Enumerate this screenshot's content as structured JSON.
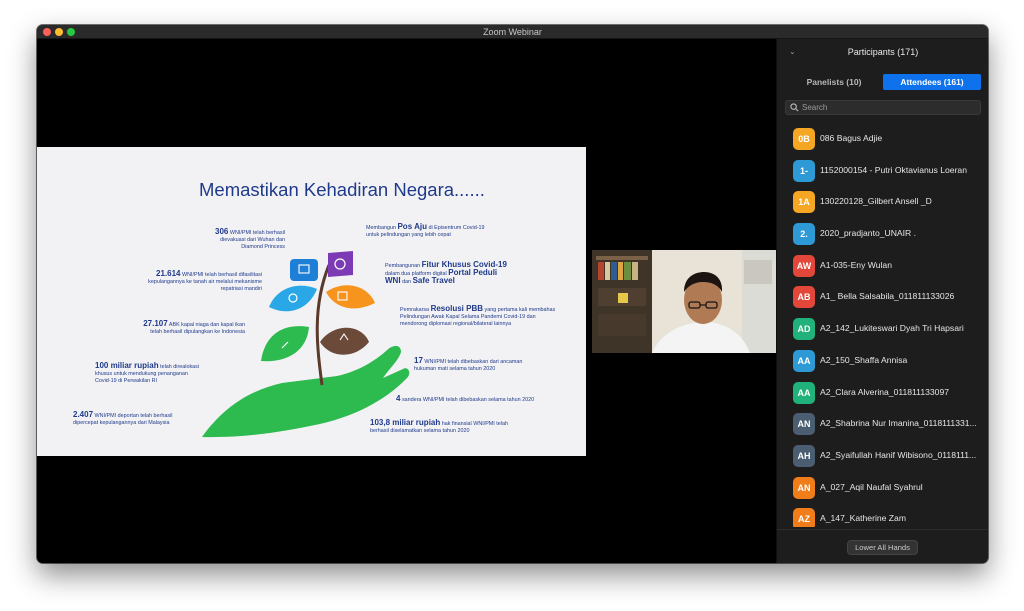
{
  "window": {
    "title": "Zoom Webinar"
  },
  "slide": {
    "title": "Memastikan Kehadiran Negara......",
    "left": [
      {
        "big": "306",
        "text": "WNI/PMI telah berhasil",
        "l2": "dievakuasi dari Wuhan dan",
        "l3": "Diamond Princess"
      },
      {
        "big": "21.614",
        "text": "WNI/PMI telah berhasil difasilitasi",
        "l2": "kepulangannya ke tanah air melalui mekanisme",
        "l3": "repatriasi mandiri"
      },
      {
        "big": "27.107",
        "text": "ABK kapal niaga dan kapal ikan",
        "l2": "telah berhasil dipulangkan ke Indonesia",
        "l3": ""
      },
      {
        "big": "100 miliar rupiah",
        "text": "telah direalokasi",
        "l2": "khusus untuk mendukung penanganan",
        "l3": "Covid-19 di Perwakilan RI"
      },
      {
        "big": "2.407",
        "text": "WNI/PMI deportan telah berhasil",
        "l2": "dipercepat kepulangannya dari Malaysia",
        "l3": ""
      }
    ],
    "right": [
      {
        "pre": "Membangun",
        "big": "Pos Aju",
        "post": "di Episentrum Covid-19",
        "l2": "untuk pelindungan yang lebih cepat"
      },
      {
        "pre": "Pembangunan",
        "big": "Fitur Khusus Covid-19",
        "post": "",
        "l2": "dalam dua platform digital",
        "big2": "Portal Peduli",
        "l3big": "WNI",
        "l3mid": "dan",
        "l3big2": "Safe Travel"
      },
      {
        "pre": "Pemrakarsa",
        "big": "Resolusi PBB",
        "post": "yang pertama kali membahas",
        "l2": "Pelindungan Awak Kapal Selama Pandemi Covid-19 dan",
        "l3": "mendorong diplomasi regional/bilateral lainnya"
      },
      {
        "pre": "",
        "big": "17",
        "post": "WNI/PMI telah dibebaskan dari ancaman",
        "l2": "hukuman mati selama tahun 2020"
      },
      {
        "pre": "",
        "big": "4",
        "post": "sandera WNI/PMI telah dibebaskan selama tahun 2020",
        "l2": ""
      },
      {
        "pre": "",
        "big": "103,8 miliar rupiah",
        "post": "hak finansial WNI/PMI telah",
        "l2": "berhasil diselamatkan selama tahun 2020"
      }
    ]
  },
  "panel": {
    "title": "Participants (171)",
    "tabs": [
      "Panelists (10)",
      "Attendees (161)"
    ],
    "search_placeholder": "Search",
    "footer_button": "Lower All Hands",
    "participants": [
      {
        "initials": "0B",
        "name": "086 Bagus Adjie",
        "color": "#f5a623"
      },
      {
        "initials": "1-",
        "name": "1152000154 - Putri Oktavianus Loeran",
        "color": "#2d9ad6"
      },
      {
        "initials": "1A",
        "name": "130220128_Gilbert Ansell _D",
        "color": "#f5a623"
      },
      {
        "initials": "2.",
        "name": "2020_pradjanto_UNAIR .",
        "color": "#2d9ad6"
      },
      {
        "initials": "AW",
        "name": "A1-035-Eny Wulan",
        "color": "#e2473a"
      },
      {
        "initials": "AB",
        "name": "A1_ Bella Salsabila_011811133026",
        "color": "#e2473a"
      },
      {
        "initials": "AD",
        "name": "A2_142_Lukiteswari Dyah Tri Hapsari",
        "color": "#20b27a"
      },
      {
        "initials": "AA",
        "name": "A2_150_Shaffa Annisa",
        "color": "#2d9ad6"
      },
      {
        "initials": "AA",
        "name": "A2_Clara Alverina_011811133097",
        "color": "#20b27a"
      },
      {
        "initials": "AN",
        "name": "A2_Shabrina Nur Imanina_0118111331...",
        "color": "#4b5d70"
      },
      {
        "initials": "AH",
        "name": "A2_Syaifullah Hanif Wibisono_0118111...",
        "color": "#4b5d70"
      },
      {
        "initials": "AN",
        "name": "A_027_Aqil Naufal Syahrul",
        "color": "#f07d1a"
      },
      {
        "initials": "AZ",
        "name": "A_147_Katherine Zam",
        "color": "#f07d1a"
      }
    ]
  }
}
